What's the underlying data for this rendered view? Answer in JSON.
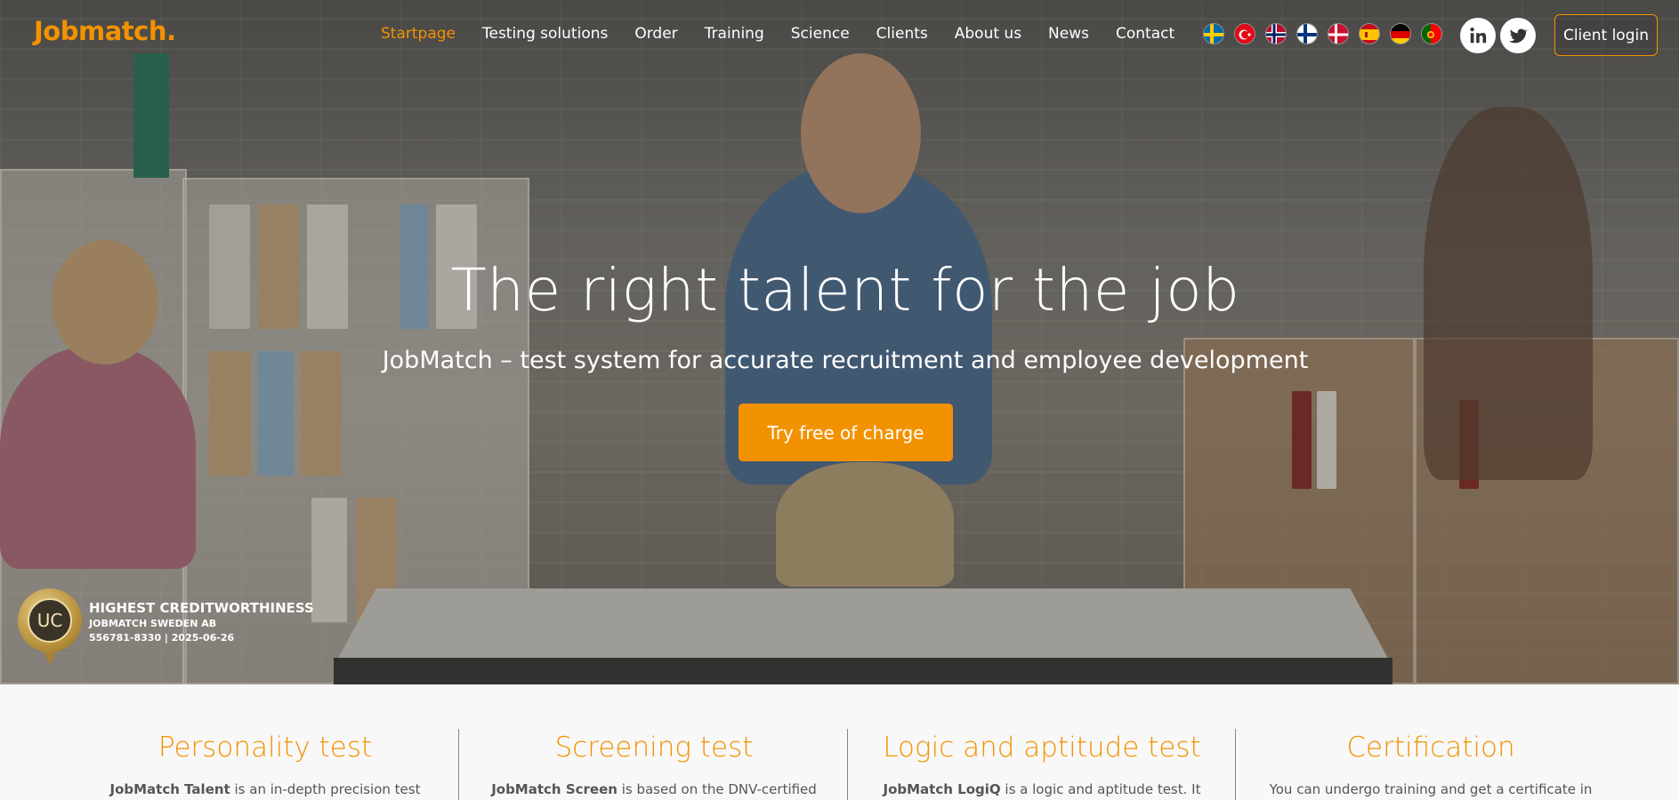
{
  "brand": {
    "logo_text": "Jobmatch.",
    "accent_color": "#f39200"
  },
  "nav": {
    "items": [
      {
        "label": "Startpage",
        "active": true
      },
      {
        "label": "Testing solutions",
        "active": false
      },
      {
        "label": "Order",
        "active": false
      },
      {
        "label": "Training",
        "active": false
      },
      {
        "label": "Science",
        "active": false
      },
      {
        "label": "Clients",
        "active": false
      },
      {
        "label": "About us",
        "active": false
      },
      {
        "label": "News",
        "active": false
      },
      {
        "label": "Contact",
        "active": false
      }
    ],
    "languages": [
      "swedish-flag",
      "turkish-flag",
      "norwegian-flag",
      "finnish-flag",
      "danish-flag",
      "spanish-flag",
      "german-flag",
      "portuguese-flag"
    ],
    "social": [
      "linkedin-icon",
      "twitter-icon"
    ],
    "client_login": "Client login"
  },
  "hero": {
    "title": "The right talent for the job",
    "subtitle": "JobMatch – test system for accurate recruitment and employee development",
    "cta_label": "Try free of charge"
  },
  "badge": {
    "logo_text": "UC",
    "line1": "HIGHEST CREDITWORTHINESS",
    "line2": "JOBMATCH SWEDEN AB",
    "line3": "556781-8330 | 2025-06-26"
  },
  "features": [
    {
      "title": "Personality test",
      "text_bold": "JobMatch Talent",
      "text": " is an in-depth precision test for"
    },
    {
      "title": "Screening test",
      "text_bold": "JobMatch Screen",
      "text": " is based on the DNV-certified"
    },
    {
      "title": "Logic and aptitude test",
      "text_bold": "JobMatch LogiQ",
      "text": " is a logic and aptitude test. It"
    },
    {
      "title": "Certification",
      "text_bold": "",
      "text": "You can undergo training and get a certificate in"
    }
  ]
}
